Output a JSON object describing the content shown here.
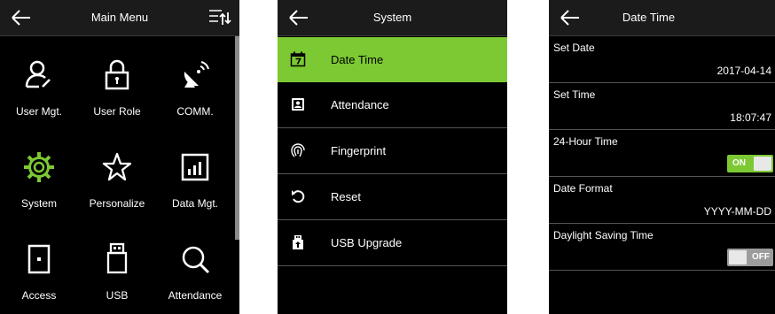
{
  "main_menu": {
    "title": "Main Menu",
    "items": [
      {
        "label": "User Mgt.",
        "icon": "user-mgt-icon"
      },
      {
        "label": "User Role",
        "icon": "user-role-icon"
      },
      {
        "label": "COMM.",
        "icon": "comm-icon"
      },
      {
        "label": "System",
        "icon": "system-gear-icon"
      },
      {
        "label": "Personalize",
        "icon": "personalize-star-icon"
      },
      {
        "label": "Data Mgt.",
        "icon": "data-mgt-icon"
      },
      {
        "label": "Access",
        "icon": "access-door-icon"
      },
      {
        "label": "USB",
        "icon": "usb-icon"
      },
      {
        "label": "Attendance",
        "icon": "attendance-search-icon"
      }
    ]
  },
  "system": {
    "title": "System",
    "items": [
      {
        "label": "Date Time",
        "icon": "calendar-icon",
        "selected": true
      },
      {
        "label": "Attendance",
        "icon": "attendance-icon"
      },
      {
        "label": "Fingerprint",
        "icon": "fingerprint-icon"
      },
      {
        "label": "Reset",
        "icon": "reset-icon"
      },
      {
        "label": "USB Upgrade",
        "icon": "usb-upgrade-icon"
      }
    ]
  },
  "date_time": {
    "title": "Date Time",
    "set_date": {
      "label": "Set Date",
      "value": "2017-04-14"
    },
    "set_time": {
      "label": "Set Time",
      "value": "18:07:47"
    },
    "hour24": {
      "label": "24-Hour Time",
      "state": "ON"
    },
    "date_format": {
      "label": "Date Format",
      "value": "YYYY-MM-DD"
    },
    "dst": {
      "label": "Daylight Saving Time",
      "state": "OFF"
    }
  },
  "colors": {
    "accent": "#7cc933",
    "background": "#000000",
    "header": "#1b1b1b"
  }
}
